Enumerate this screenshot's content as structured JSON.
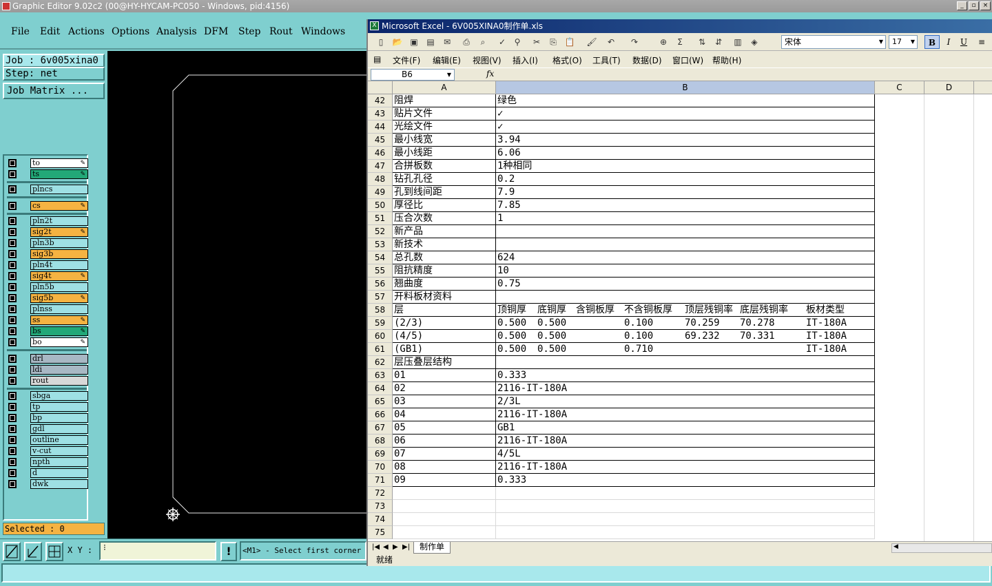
{
  "ge": {
    "title": "Graphic Editor 9.02c2 (00@HY-HYCAM-PC050 - Windows, pid:4156)",
    "menu": [
      "File",
      "Edit",
      "Actions",
      "Options",
      "Analysis",
      "DFM",
      "Step",
      "Rout",
      "Windows"
    ],
    "job": "Job : 6v005xina0",
    "step": "Step: net",
    "job_matrix": "Job Matrix ...",
    "layers": [
      {
        "name": "to",
        "color": "#ffffff",
        "mark": "✎"
      },
      {
        "name": "ts",
        "color": "#22a878",
        "mark": "✎"
      },
      {
        "name": "plncs",
        "color": "#9ee0e4",
        "mark": ""
      },
      {
        "name": "cs",
        "color": "#f5b342",
        "mark": "✎"
      },
      {
        "name": "pln2t",
        "color": "#9ee0e4",
        "mark": ""
      },
      {
        "name": "sig2t",
        "color": "#f5b342",
        "mark": "✎"
      },
      {
        "name": "pln3b",
        "color": "#9ee0e4",
        "mark": ""
      },
      {
        "name": "sig3b",
        "color": "#f5b342",
        "mark": ""
      },
      {
        "name": "pln4t",
        "color": "#9ee0e4",
        "mark": ""
      },
      {
        "name": "sig4t",
        "color": "#f5b342",
        "mark": "✎"
      },
      {
        "name": "pln5b",
        "color": "#9ee0e4",
        "mark": ""
      },
      {
        "name": "sig5b",
        "color": "#f5b342",
        "mark": "✎"
      },
      {
        "name": "plnss",
        "color": "#9ee0e4",
        "mark": ""
      },
      {
        "name": "ss",
        "color": "#f5b342",
        "mark": "✎"
      },
      {
        "name": "bs",
        "color": "#22a878",
        "mark": "✎"
      },
      {
        "name": "bo",
        "color": "#ffffff",
        "mark": "✎"
      },
      {
        "name": "drl",
        "color": "#a8b8c4",
        "mark": ""
      },
      {
        "name": "ldi",
        "color": "#a8b8c4",
        "mark": ""
      },
      {
        "name": "rout",
        "color": "#d8d8d8",
        "mark": ""
      },
      {
        "name": "sbga",
        "color": "#9ee0e4",
        "mark": ""
      },
      {
        "name": "tp",
        "color": "#9ee0e4",
        "mark": ""
      },
      {
        "name": "bp",
        "color": "#9ee0e4",
        "mark": ""
      },
      {
        "name": "gdl",
        "color": "#9ee0e4",
        "mark": ""
      },
      {
        "name": "outline",
        "color": "#9ee0e4",
        "mark": ""
      },
      {
        "name": "v-cut",
        "color": "#9ee0e4",
        "mark": ""
      },
      {
        "name": "npth",
        "color": "#9ee0e4",
        "mark": ""
      },
      {
        "name": "d",
        "color": "#9ee0e4",
        "mark": ""
      },
      {
        "name": "dwk",
        "color": "#9ee0e4",
        "mark": ""
      }
    ],
    "selected": "Selected : 0",
    "xy_label": "X Y :",
    "prompt": "<M1> - Select first corner"
  },
  "excel": {
    "title": "Microsoft Excel - 6V005XINA0制作单.xls",
    "font": "宋体",
    "size": "17",
    "menu": [
      "文件(F)",
      "编辑(E)",
      "视图(V)",
      "插入(I)",
      "格式(O)",
      "工具(T)",
      "数据(D)",
      "窗口(W)",
      "帮助(H)"
    ],
    "namebox": "B6",
    "fx": "fx",
    "cols": [
      "A",
      "B",
      "C",
      "D"
    ],
    "rows": [
      {
        "n": "42",
        "a": "阻焊",
        "b": "绿色"
      },
      {
        "n": "43",
        "a": "贴片文件",
        "b": "✓"
      },
      {
        "n": "44",
        "a": "光绘文件",
        "b": "✓"
      },
      {
        "n": "45",
        "a": "最小线宽",
        "b": "3.94"
      },
      {
        "n": "46",
        "a": "最小线距",
        "b": "6.06"
      },
      {
        "n": "47",
        "a": "合拼板数",
        "b": "1种相同"
      },
      {
        "n": "48",
        "a": "钻孔孔径",
        "b": "0.2"
      },
      {
        "n": "49",
        "a": "孔到线间距",
        "b": "7.9"
      },
      {
        "n": "50",
        "a": "厚径比",
        "b": "7.85"
      },
      {
        "n": "51",
        "a": "压合次数",
        "b": "1"
      },
      {
        "n": "52",
        "a": "新产品",
        "b": ""
      },
      {
        "n": "53",
        "a": "新技术",
        "b": ""
      },
      {
        "n": "54",
        "a": "总孔数",
        "b": "624"
      },
      {
        "n": "55",
        "a": "阻抗精度",
        "b": "10"
      },
      {
        "n": "56",
        "a": "翘曲度",
        "b": "0.75"
      },
      {
        "n": "57",
        "a": "开料板材资料",
        "b": ""
      },
      {
        "n": "58",
        "a": "层",
        "b": ""
      },
      {
        "n": "59",
        "a": "(2/3)",
        "b": ""
      },
      {
        "n": "60",
        "a": "(4/5)",
        "b": ""
      },
      {
        "n": "61",
        "a": "(GB1)",
        "b": ""
      },
      {
        "n": "62",
        "a": "层压叠层结构",
        "b": ""
      },
      {
        "n": "63",
        "a": "01",
        "b": "0.333"
      },
      {
        "n": "64",
        "a": "02",
        "b": "2116-IT-180A"
      },
      {
        "n": "65",
        "a": "03",
        "b": "2/3L"
      },
      {
        "n": "66",
        "a": "04",
        "b": "2116-IT-180A"
      },
      {
        "n": "67",
        "a": "05",
        "b": "GB1"
      },
      {
        "n": "68",
        "a": "06",
        "b": "2116-IT-180A"
      },
      {
        "n": "69",
        "a": "07",
        "b": "4/5L"
      },
      {
        "n": "70",
        "a": "08",
        "b": "2116-IT-180A"
      },
      {
        "n": "71",
        "a": "09",
        "b": "0.333"
      },
      {
        "n": "72",
        "a": "",
        "b": ""
      },
      {
        "n": "73",
        "a": "",
        "b": ""
      },
      {
        "n": "74",
        "a": "",
        "b": ""
      },
      {
        "n": "75",
        "a": "",
        "b": ""
      }
    ],
    "subheader": [
      "顶铜厚",
      "底铜厚",
      "含铜板厚",
      "不含铜板厚",
      "顶层残铜率",
      "底层残铜率",
      "板材类型"
    ],
    "subrows": [
      [
        "0.500",
        "0.500",
        "",
        "0.100",
        "70.259",
        "70.278",
        "IT-180A"
      ],
      [
        "0.500",
        "0.500",
        "",
        "0.100",
        "69.232",
        "70.331",
        "IT-180A"
      ],
      [
        "0.500",
        "0.500",
        "",
        "0.710",
        "",
        "",
        "IT-180A"
      ]
    ],
    "sheet_tab": "制作单",
    "status": "就绪"
  }
}
